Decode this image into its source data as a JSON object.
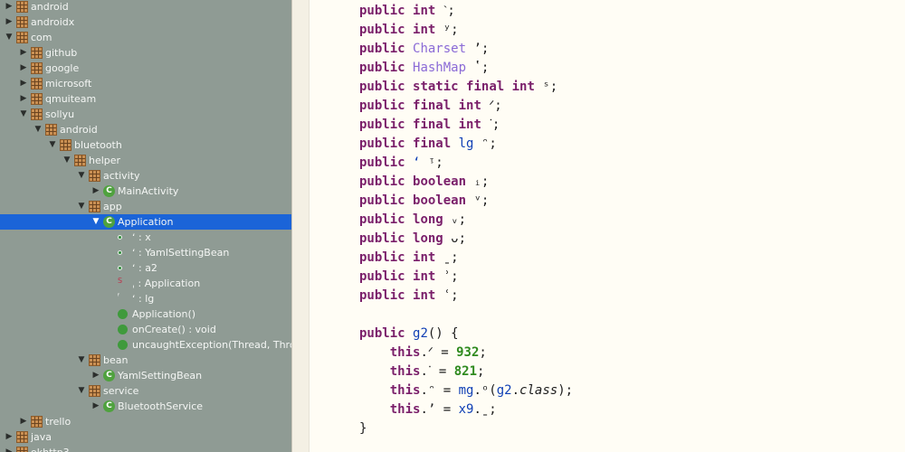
{
  "tree": [
    {
      "label": "android",
      "indent": 0,
      "arrow": "▶",
      "icon": "package"
    },
    {
      "label": "androidx",
      "indent": 0,
      "arrow": "▶",
      "icon": "package"
    },
    {
      "label": "com",
      "indent": 0,
      "arrow": "▼",
      "icon": "package"
    },
    {
      "label": "github",
      "indent": 1,
      "arrow": "▶",
      "icon": "package"
    },
    {
      "label": "google",
      "indent": 1,
      "arrow": "▶",
      "icon": "package"
    },
    {
      "label": "microsoft",
      "indent": 1,
      "arrow": "▶",
      "icon": "package"
    },
    {
      "label": "qmuiteam",
      "indent": 1,
      "arrow": "▶",
      "icon": "package"
    },
    {
      "label": "sollyu",
      "indent": 1,
      "arrow": "▼",
      "icon": "package"
    },
    {
      "label": "android",
      "indent": 2,
      "arrow": "▼",
      "icon": "package"
    },
    {
      "label": "bluetooth",
      "indent": 3,
      "arrow": "▼",
      "icon": "package"
    },
    {
      "label": "helper",
      "indent": 4,
      "arrow": "▼",
      "icon": "package"
    },
    {
      "label": "activity",
      "indent": 5,
      "arrow": "▼",
      "icon": "package"
    },
    {
      "label": "MainActivity",
      "indent": 6,
      "arrow": "▶",
      "icon": "class"
    },
    {
      "label": "app",
      "indent": 5,
      "arrow": "▼",
      "icon": "package"
    },
    {
      "label": "Application",
      "indent": 6,
      "arrow": "▼",
      "icon": "class",
      "selected": true
    },
    {
      "label": "ʻ : ⅹ",
      "indent": 7,
      "arrow": "",
      "icon": "field"
    },
    {
      "label": "ʻ : YamlSettingBean",
      "indent": 7,
      "arrow": "",
      "icon": "field"
    },
    {
      "label": "ʻ : a2",
      "indent": 7,
      "arrow": "",
      "icon": "field"
    },
    {
      "label": "ˌ : Application",
      "indent": 7,
      "arrow": "",
      "icon": "static"
    },
    {
      "label": "ʻ : lg",
      "indent": 7,
      "arrow": "",
      "icon": "final"
    },
    {
      "label": "Application()",
      "indent": 7,
      "arrow": "",
      "icon": "ctor"
    },
    {
      "label": "onCreate() : void",
      "indent": 7,
      "arrow": "",
      "icon": "method"
    },
    {
      "label": "uncaughtException(Thread, Thro",
      "indent": 7,
      "arrow": "",
      "icon": "method"
    },
    {
      "label": "bean",
      "indent": 5,
      "arrow": "▼",
      "icon": "package"
    },
    {
      "label": "YamlSettingBean",
      "indent": 6,
      "arrow": "▶",
      "icon": "class"
    },
    {
      "label": "service",
      "indent": 5,
      "arrow": "▼",
      "icon": "package"
    },
    {
      "label": "BluetoothService",
      "indent": 6,
      "arrow": "▶",
      "icon": "class"
    },
    {
      "label": "trello",
      "indent": 1,
      "arrow": "▶",
      "icon": "package"
    },
    {
      "label": "java",
      "indent": 0,
      "arrow": "▶",
      "icon": "package"
    },
    {
      "label": "okhttp3",
      "indent": 0,
      "arrow": "▶",
      "icon": "package"
    }
  ],
  "code": [
    [
      [
        "kw",
        "public "
      ],
      [
        "kw",
        "int "
      ],
      [
        "t",
        "ˋ;"
      ]
    ],
    [
      [
        "kw",
        "public "
      ],
      [
        "kw",
        "int "
      ],
      [
        "t",
        "ʸ;"
      ]
    ],
    [
      [
        "kw",
        "public "
      ],
      [
        "tp",
        "Charset "
      ],
      [
        "t",
        "ʼ;"
      ]
    ],
    [
      [
        "kw",
        "public "
      ],
      [
        "tp",
        "HashMap "
      ],
      [
        "t",
        "ʽ;"
      ]
    ],
    [
      [
        "kw",
        "public "
      ],
      [
        "kw",
        "static "
      ],
      [
        "kw",
        "final "
      ],
      [
        "kw",
        "int "
      ],
      [
        "t",
        "ˢ;"
      ]
    ],
    [
      [
        "kw",
        "public "
      ],
      [
        "kw",
        "final "
      ],
      [
        "kw",
        "int "
      ],
      [
        "t",
        "ᐟ;"
      ]
    ],
    [
      [
        "kw",
        "public "
      ],
      [
        "kw",
        "final "
      ],
      [
        "kw",
        "int "
      ],
      [
        "t",
        "ᐝ;"
      ]
    ],
    [
      [
        "kw",
        "public "
      ],
      [
        "kw",
        "final "
      ],
      [
        "nm",
        "lg "
      ],
      [
        "t",
        "ᵔ;"
      ]
    ],
    [
      [
        "kw",
        "public "
      ],
      [
        "nm",
        "ʻ "
      ],
      [
        "t",
        "ᵎ;"
      ]
    ],
    [
      [
        "kw",
        "public "
      ],
      [
        "kw",
        "boolean "
      ],
      [
        "t",
        "ᵢ;"
      ]
    ],
    [
      [
        "kw",
        "public "
      ],
      [
        "kw",
        "boolean "
      ],
      [
        "t",
        "ᵛ;"
      ]
    ],
    [
      [
        "kw",
        "public "
      ],
      [
        "kw",
        "long "
      ],
      [
        "t",
        "ᵥ;"
      ]
    ],
    [
      [
        "kw",
        "public "
      ],
      [
        "kw",
        "long "
      ],
      [
        "t",
        "ᴗ;"
      ]
    ],
    [
      [
        "kw",
        "public "
      ],
      [
        "kw",
        "int "
      ],
      [
        "t",
        "ˍ;"
      ]
    ],
    [
      [
        "kw",
        "public "
      ],
      [
        "kw",
        "int "
      ],
      [
        "t",
        "ʾ;"
      ]
    ],
    [
      [
        "kw",
        "public "
      ],
      [
        "kw",
        "int "
      ],
      [
        "t",
        "ʿ;"
      ]
    ],
    [],
    [
      [
        "kw",
        "public "
      ],
      [
        "nm",
        "g2"
      ],
      [
        "t",
        "() {"
      ]
    ],
    [
      [
        "t",
        "    "
      ],
      [
        "kw",
        "this"
      ],
      [
        "t",
        ".ᐟ = "
      ],
      [
        "num",
        "932"
      ],
      [
        "t",
        ";"
      ]
    ],
    [
      [
        "t",
        "    "
      ],
      [
        "kw",
        "this"
      ],
      [
        "t",
        ".ᐝ = "
      ],
      [
        "num",
        "821"
      ],
      [
        "t",
        ";"
      ]
    ],
    [
      [
        "t",
        "    "
      ],
      [
        "kw",
        "this"
      ],
      [
        "t",
        ".ᵔ = "
      ],
      [
        "nm",
        "mg"
      ],
      [
        "t",
        ".ᵒ("
      ],
      [
        "nm",
        "g2"
      ],
      [
        "t",
        "."
      ],
      [
        "it",
        "class"
      ],
      [
        "t",
        ");"
      ]
    ],
    [
      [
        "t",
        "    "
      ],
      [
        "kw",
        "this"
      ],
      [
        "t",
        ".ʼ = "
      ],
      [
        "nm",
        "x9"
      ],
      [
        "t",
        ".ˍ;"
      ]
    ],
    [
      [
        "t",
        "}"
      ]
    ]
  ]
}
